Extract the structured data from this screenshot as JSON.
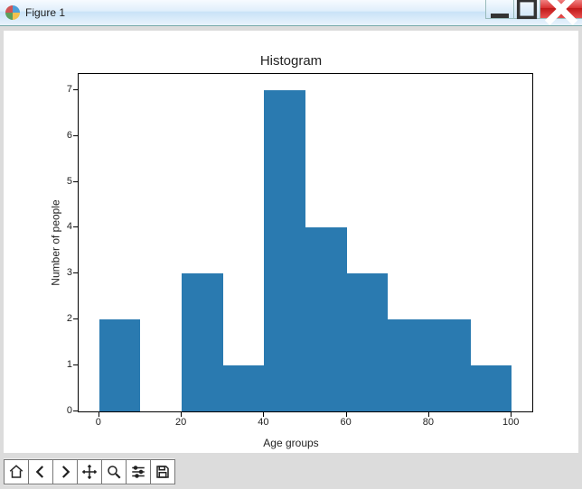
{
  "window": {
    "title": "Figure 1"
  },
  "chart_data": {
    "type": "bar",
    "title": "Histogram",
    "xlabel": "Age groups",
    "ylabel": "Number of people",
    "xlim": [
      -5,
      105
    ],
    "ylim": [
      0,
      7.35
    ],
    "xticks": [
      0,
      20,
      40,
      60,
      80,
      100
    ],
    "yticks": [
      0,
      1,
      2,
      3,
      4,
      5,
      6,
      7
    ],
    "bin_edges": [
      0,
      10,
      20,
      30,
      40,
      50,
      60,
      70,
      80,
      90,
      100
    ],
    "values": [
      2,
      0,
      3,
      1,
      7,
      4,
      3,
      2,
      2,
      1
    ],
    "bar_color": "#2a7ab0"
  }
}
